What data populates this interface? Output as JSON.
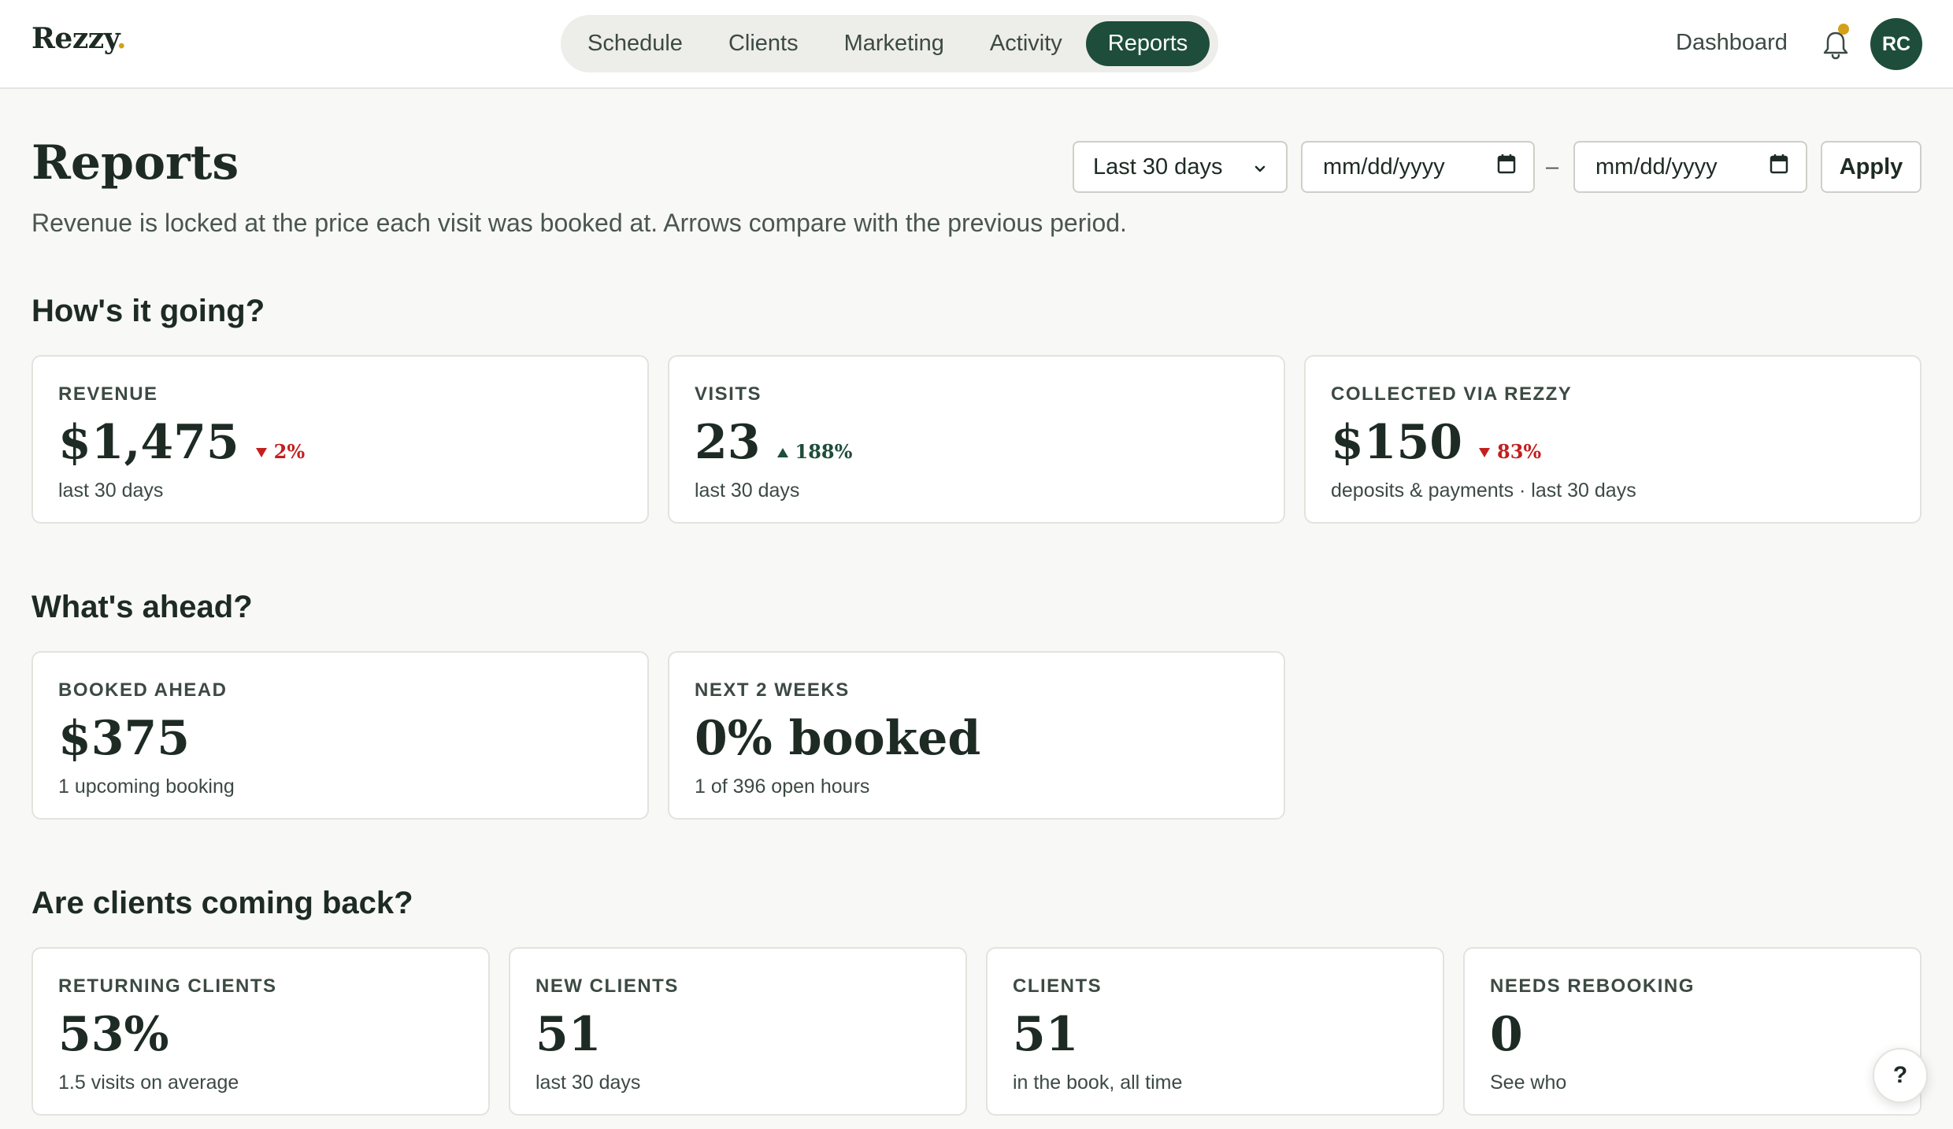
{
  "header": {
    "logo": "Rezzy",
    "logo_dot": ".",
    "nav": [
      "Schedule",
      "Clients",
      "Marketing",
      "Activity",
      "Reports"
    ],
    "active_nav": "Reports",
    "dashboard_link": "Dashboard",
    "avatar_initials": "RC",
    "accent_color": "#1e4d3b",
    "notification_dot_color": "#d4a017"
  },
  "page": {
    "title": "Reports",
    "subtitle": "Revenue is locked at the price each visit was booked at. Arrows compare with the previous period."
  },
  "filters": {
    "range_value": "Last 30 days",
    "start_placeholder": "mm/dd/yyyy",
    "separator": "–",
    "end_placeholder": "mm/dd/yyyy",
    "apply_label": "Apply"
  },
  "sections": {
    "going": {
      "title": "How's it going?",
      "cards": [
        {
          "label": "REVENUE",
          "value": "$1,475",
          "delta": "2%",
          "delta_dir": "down",
          "sub": "last 30 days"
        },
        {
          "label": "VISITS",
          "value": "23",
          "delta": "188%",
          "delta_dir": "up",
          "sub": "last 30 days"
        },
        {
          "label": "COLLECTED VIA REZZY",
          "value": "$150",
          "delta": "83%",
          "delta_dir": "down",
          "sub": "deposits & payments · last 30 days"
        }
      ]
    },
    "ahead": {
      "title": "What's ahead?",
      "cards": [
        {
          "label": "BOOKED AHEAD",
          "value": "$375",
          "sub": "1 upcoming booking"
        },
        {
          "label": "NEXT 2 WEEKS",
          "value": "0% booked",
          "sub": "1 of 396 open hours"
        }
      ]
    },
    "returning": {
      "title": "Are clients coming back?",
      "cards": [
        {
          "label": "RETURNING CLIENTS",
          "value": "53%",
          "sub": "1.5 visits on average"
        },
        {
          "label": "NEW CLIENTS",
          "value": "51",
          "sub": "last 30 days"
        },
        {
          "label": "CLIENTS",
          "value": "51",
          "sub": "in the book, all time"
        },
        {
          "label": "NEEDS REBOOKING",
          "value": "0",
          "sub": "See who"
        }
      ]
    }
  },
  "help_label": "?",
  "icons": {
    "bell": "bell-icon",
    "calendar": "calendar-icon",
    "chevron": "chevron-down-icon",
    "arrow_down": "triangle-down-icon",
    "arrow_up": "triangle-up-icon"
  }
}
